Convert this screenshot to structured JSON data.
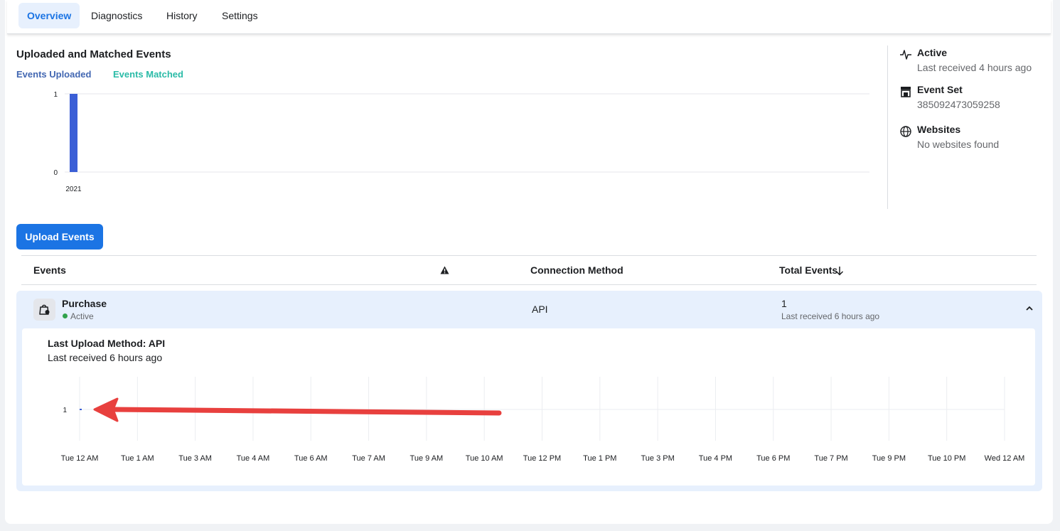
{
  "tabs": [
    {
      "label": "Overview",
      "active": true
    },
    {
      "label": "Diagnostics",
      "active": false
    },
    {
      "label": "History",
      "active": false
    },
    {
      "label": "Settings",
      "active": false
    }
  ],
  "overview": {
    "title": "Uploaded and Matched Events",
    "legend": [
      {
        "label": "Events Uploaded",
        "color": "#4267b2"
      },
      {
        "label": "Events Matched",
        "color": "#2abba7"
      }
    ]
  },
  "side_panel": {
    "status": {
      "title": "Active",
      "sub": "Last received 4 hours ago",
      "icon": "activity-icon"
    },
    "event_set": {
      "title": "Event Set",
      "sub": "385092473059258",
      "icon": "store-icon"
    },
    "websites": {
      "title": "Websites",
      "sub": "No websites found",
      "icon": "globe-icon"
    }
  },
  "upload_button": "Upload Events",
  "table": {
    "headers": {
      "events": "Events",
      "warning_icon": "warning-icon",
      "connection": "Connection Method",
      "total": "Total Events",
      "sort_icon": "arrow-down-icon"
    },
    "rows": [
      {
        "name": "Purchase",
        "status": "Active",
        "method": "API",
        "total": "1",
        "total_sub": "Last received 6 hours ago",
        "detail": {
          "title": "Last Upload Method: API",
          "sub": "Last received 6 hours ago"
        }
      }
    ]
  },
  "chart_data": [
    {
      "type": "bar",
      "categories": [
        "2021"
      ],
      "series": [
        {
          "name": "Events Uploaded",
          "values": [
            1
          ]
        },
        {
          "name": "Events Matched",
          "values": [
            0
          ]
        }
      ],
      "yticks": [
        0,
        1
      ],
      "ylim": [
        0,
        1
      ],
      "color": "#3b5fd6"
    },
    {
      "type": "line",
      "categories": [
        "Tue 12 AM",
        "Tue 1 AM",
        "Tue 3 AM",
        "Tue 4 AM",
        "Tue 6 AM",
        "Tue 7 AM",
        "Tue 9 AM",
        "Tue 10 AM",
        "Tue 12 PM",
        "Tue 1 PM",
        "Tue 3 PM",
        "Tue 4 PM",
        "Tue 6 PM",
        "Tue 7 PM",
        "Tue 9 PM",
        "Tue 10 PM",
        "Wed 12 AM"
      ],
      "values": [
        1
      ],
      "yticks": [
        1
      ],
      "color": "#3b5fd6"
    }
  ],
  "annotation_color": "#e8403e"
}
